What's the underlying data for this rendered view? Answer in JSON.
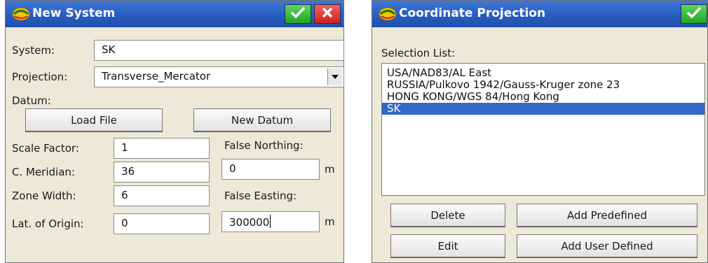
{
  "new_system": {
    "title": "New System",
    "ok_icon": "checkmark-icon",
    "cancel_icon": "close-icon",
    "system_label": "System:",
    "system_value": "SK",
    "projection_label": "Projection:",
    "projection_value": "Transverse_Mercator",
    "datum_label": "Datum:",
    "load_file_label": "Load File",
    "new_datum_label": "New Datum",
    "scale_factor_label": "Scale Factor:",
    "scale_factor_value": "1",
    "c_meridian_label": "C. Meridian:",
    "c_meridian_value": "36",
    "zone_width_label": "Zone Width:",
    "zone_width_value": "6",
    "lat_origin_label": "Lat. of Origin:",
    "lat_origin_value": "0",
    "false_northing_label": "False Northing:",
    "false_northing_value": "0",
    "false_northing_unit": "m",
    "false_easting_label": "False Easting:",
    "false_easting_value": "300000",
    "false_easting_unit": "m"
  },
  "coord_projection": {
    "title": "Coordinate Projection",
    "ok_icon": "checkmark-icon",
    "selection_label": "Selection List:",
    "items": [
      "USA/NAD83/AL East",
      "RUSSIA/Pulkovo 1942/Gauss-Kruger zone 23",
      "HONG KONG/WGS 84/Hong Kong",
      "SK"
    ],
    "selected_index": 3,
    "delete_label": "Delete",
    "add_predefined_label": "Add Predefined",
    "edit_label": "Edit",
    "add_user_defined_label": "Add User Defined"
  },
  "colors": {
    "titlebar": "#2a5cc0",
    "window_bg": "#ece9d8",
    "ok_green": "#22a722",
    "cancel_red": "#cf1f1f",
    "selection": "#3367c8"
  }
}
